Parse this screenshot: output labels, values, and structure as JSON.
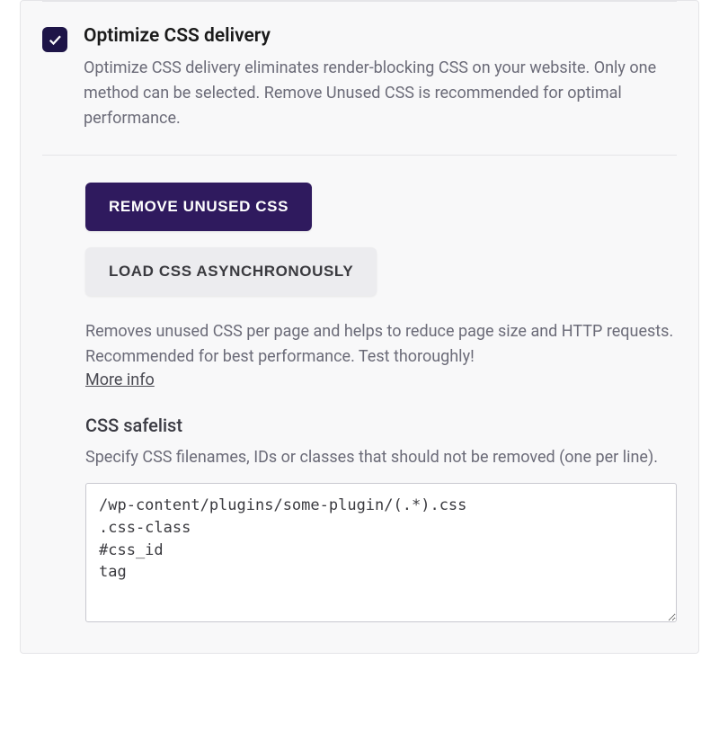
{
  "option": {
    "title": "Optimize CSS delivery",
    "description": "Optimize CSS delivery eliminates render-blocking CSS on your website. Only one method can be selected. Remove Unused CSS is recommended for optimal performance."
  },
  "buttons": {
    "remove_unused": "Remove Unused CSS",
    "load_async": "Load CSS Asynchronously"
  },
  "sub": {
    "description": "Removes unused CSS per page and helps to reduce page size and HTTP requests. Recommended for best performance. Test thoroughly!",
    "more_info": "More info"
  },
  "safelist": {
    "title": "CSS safelist",
    "description": "Specify CSS filenames, IDs or classes that should not be removed (one per line).",
    "value": "/wp-content/plugins/some-plugin/(.*).css\n.css-class\n#css_id\ntag"
  }
}
